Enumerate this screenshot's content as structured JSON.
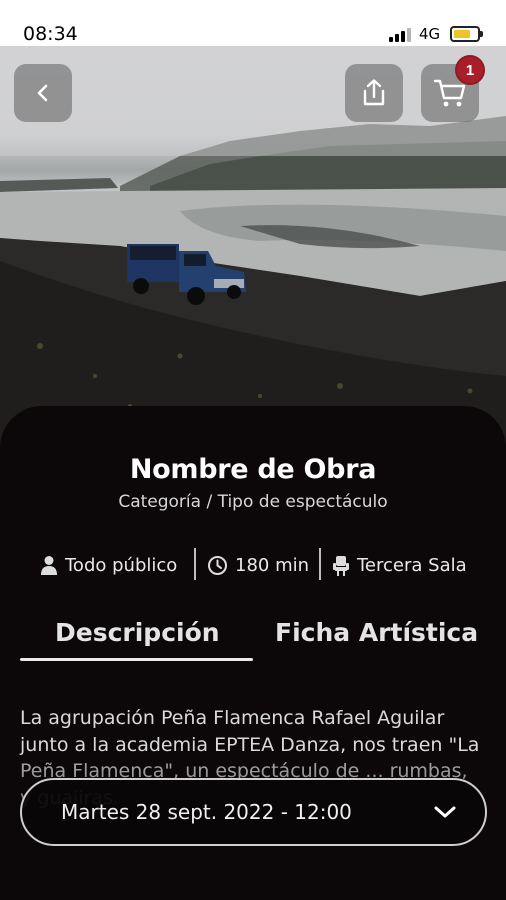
{
  "status_bar": {
    "time": "08:34",
    "network": "4G"
  },
  "header": {
    "cart_count": "1"
  },
  "event": {
    "title": "Nombre de Obra",
    "subtitle": "Categoría / Tipo de espectáculo",
    "audience": "Todo público",
    "duration": "180 min",
    "venue": "Tercera Sala"
  },
  "tabs": [
    {
      "label": "Descripción",
      "active": true
    },
    {
      "label": "Ficha Artística",
      "active": false
    }
  ],
  "description": "La agrupación Peña Flamenca Rafael Aguilar junto a la academia EPTEA Danza, nos traen \"La Peña Flamenca\", un espectáculo de ... rumbas, y guajiras.",
  "date_select": {
    "value": "Martes 28 sept. 2022 - 12:00"
  },
  "colors": {
    "accent_badge": "#a81e2b",
    "sheet_bg": "#0c0809"
  },
  "icons": [
    "back-arrow-icon",
    "share-icon",
    "cart-icon",
    "person-icon",
    "clock-icon",
    "seat-icon",
    "chevron-down-icon"
  ]
}
